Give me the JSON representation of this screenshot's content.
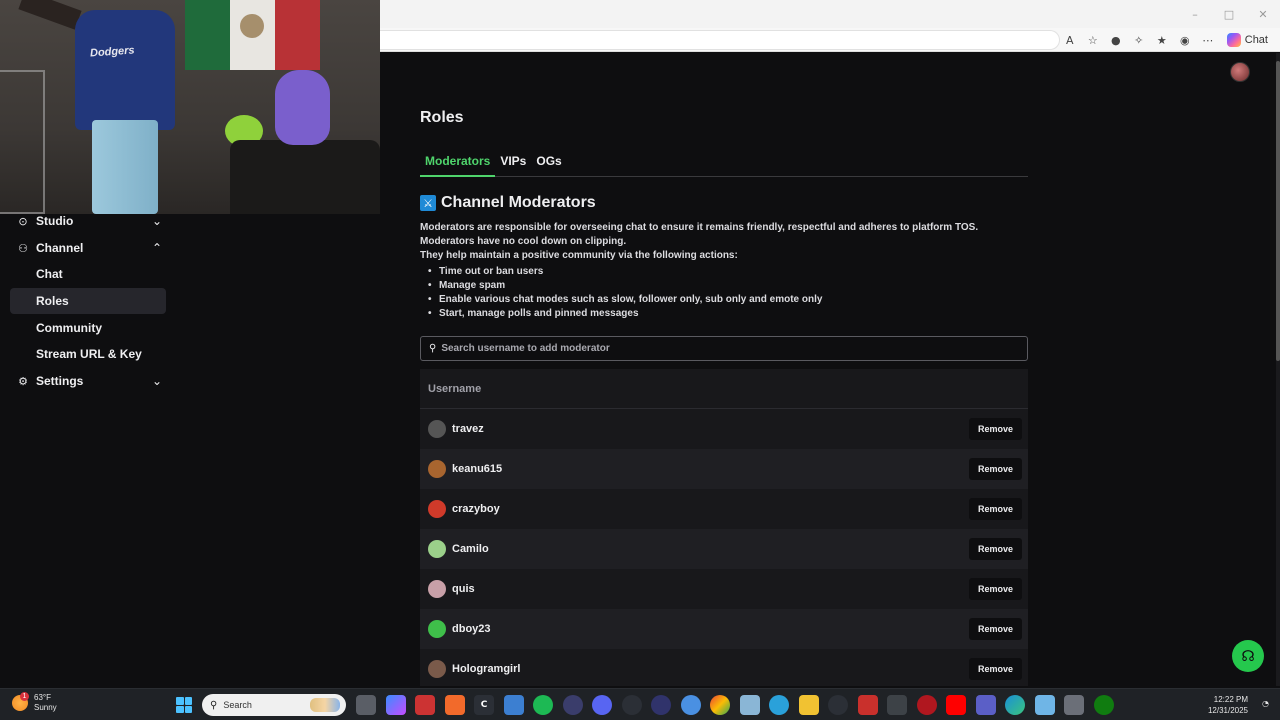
{
  "browser": {
    "window_controls": [
      "–",
      "□",
      "✕"
    ],
    "copilot_label": "Chat"
  },
  "webcam": {
    "jersey_text": "Dodgers"
  },
  "sidebar": {
    "items": [
      {
        "label": "Studio",
        "icon": "studio-icon",
        "chevron": "⌄"
      },
      {
        "label": "Channel",
        "icon": "channel-icon",
        "chevron": "⌃"
      },
      {
        "label": "Chat"
      },
      {
        "label": "Roles"
      },
      {
        "label": "Community"
      },
      {
        "label": "Stream URL & Key"
      },
      {
        "label": "Settings",
        "icon": "gear-icon",
        "chevron": "⌄"
      }
    ]
  },
  "main": {
    "title": "Roles",
    "tabs": [
      {
        "label": "Moderators"
      },
      {
        "label": "VIPs"
      },
      {
        "label": "OGs"
      }
    ],
    "section_title": "Channel Moderators",
    "description": [
      "Moderators are responsible for overseeing chat to ensure it remains friendly, respectful and adheres to platform TOS.",
      "Moderators have no cool down on clipping.",
      "They help maintain a positive community via the following actions:"
    ],
    "bullets": [
      "Time out or ban users",
      "Manage spam",
      "Enable various chat modes such as slow, follower only, sub only and emote only",
      "Start, manage polls and pinned messages"
    ],
    "search_placeholder": "Search username to add moderator",
    "table_header": "Username",
    "remove_label": "Remove",
    "moderators": [
      {
        "username": "travez",
        "avatar_color": "#555555"
      },
      {
        "username": "keanu615",
        "avatar_color": "#a8652f"
      },
      {
        "username": "crazyboy",
        "avatar_color": "#d03a2a"
      },
      {
        "username": "Camilo",
        "avatar_color": "#9bd08a"
      },
      {
        "username": "quis",
        "avatar_color": "#c8a0a8"
      },
      {
        "username": "dboy23",
        "avatar_color": "#3fbf4a"
      },
      {
        "username": "Hologramgirl",
        "avatar_color": "#7a5a4a"
      }
    ]
  },
  "taskbar": {
    "weather_temp": "63°F",
    "weather_desc": "Sunny",
    "weather_badge": "1",
    "search_placeholder": "Search",
    "time": "12:22 PM",
    "date": "12/31/2025"
  },
  "colors": {
    "accent": "#4fd46c",
    "background": "#0e0e10",
    "fab": "#25c84d"
  }
}
